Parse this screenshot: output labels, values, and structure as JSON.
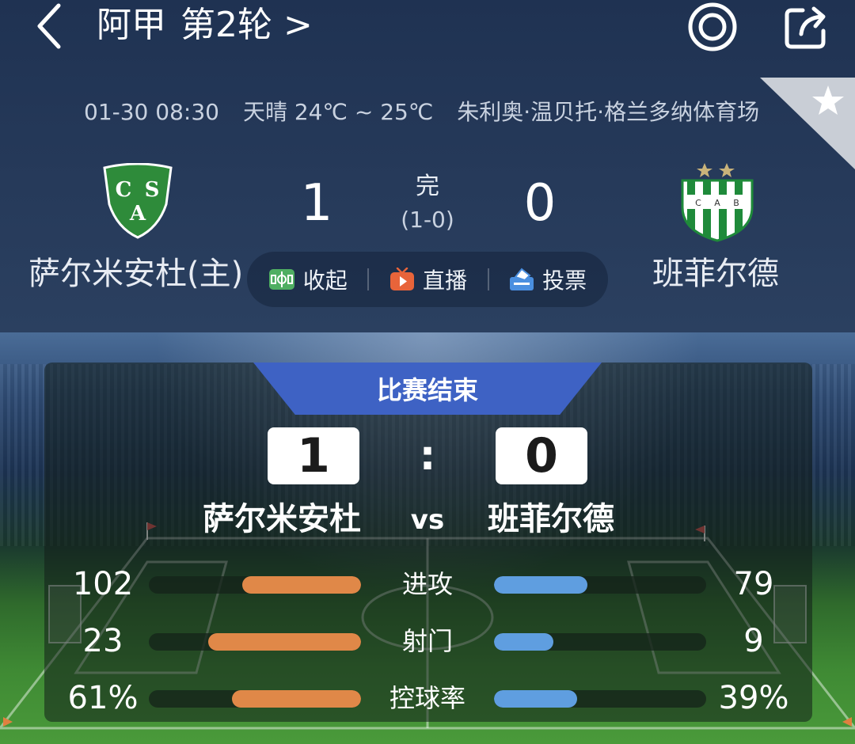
{
  "header": {
    "title": "阿甲",
    "round": "第2轮 >",
    "date_time": "01-30 08:30",
    "weather": "天晴 24℃ ~ 25℃",
    "venue": "朱利奥·温贝托·格兰多纳体育场"
  },
  "match": {
    "home_score": "1",
    "away_score": "0",
    "status": "完",
    "half_time": "(1-0)",
    "home_name": "萨尔米安杜(主)",
    "away_name": "班菲尔德"
  },
  "actions": {
    "collapse": "收起",
    "live": "直播",
    "vote": "投票"
  },
  "summary": {
    "end_label": "比赛结束",
    "home_score": "1",
    "away_score": "0",
    "colon": ":",
    "home_name": "萨尔米安杜",
    "away_name": "班菲尔德",
    "vs": "vs"
  },
  "stats": [
    {
      "label": "进攻",
      "home": "102",
      "away": "79",
      "home_frac": 0.56,
      "away_frac": 0.44
    },
    {
      "label": "射门",
      "home": "23",
      "away": "9",
      "home_frac": 0.72,
      "away_frac": 0.28
    },
    {
      "label": "控球率",
      "home": "61%",
      "away": "39%",
      "home_frac": 0.61,
      "away_frac": 0.39
    }
  ],
  "colors": {
    "home_bar": "#e08848",
    "away_bar": "#5f9ee0",
    "end_tab": "#3e62c4",
    "header_bg": "#243858",
    "home_crest": "#2e8b3a"
  },
  "icons": {
    "back": "chevron-left-icon",
    "target": "target-icon",
    "share": "share-icon",
    "favorite": "star-icon",
    "collapse": "pitch-icon",
    "live": "tv-icon",
    "vote": "ballot-icon"
  },
  "crests": {
    "home_letters": "CSA",
    "away_letters": "CAB"
  }
}
